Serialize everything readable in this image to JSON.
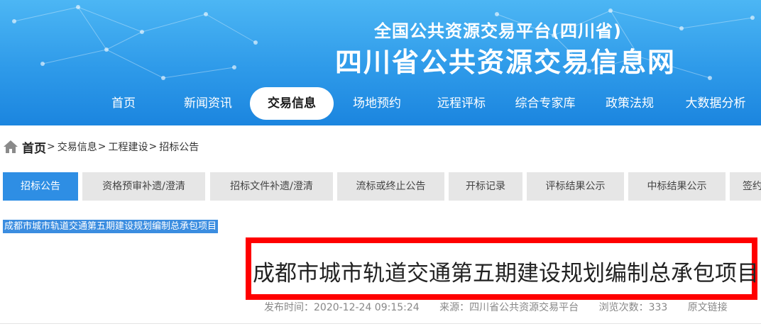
{
  "header": {
    "platform_name": "全国公共资源交易平台(四川省)",
    "site_name": "四川省公共资源交易信息网"
  },
  "nav": {
    "items": [
      "首页",
      "新闻资讯",
      "交易信息",
      "场地预约",
      "远程评标",
      "综合专家库",
      "政策法规",
      "大数据分析"
    ],
    "active": "交易信息"
  },
  "breadcrumb": {
    "home": "首页",
    "separator": ">",
    "items": [
      "交易信息",
      "工程建设",
      "招标公告"
    ]
  },
  "tabs": {
    "items": [
      "招标公告",
      "资格预审补遗/澄清",
      "招标文件补遗/澄清",
      "流标或终止公告",
      "开标记录",
      "评标结果公示",
      "中标结果公示",
      "签约"
    ],
    "active": "招标公告"
  },
  "article": {
    "highlighted_title": "成都市城市轨道交通第五期建设规划编制总承包项目",
    "title": "成都市城市轨道交通第五期建设规划编制总承包项目",
    "publish_time": "发布时间：2020-12-24 09:15:24",
    "source": "来源：四川省公共资源交易平台",
    "views": "浏览次数：333",
    "original_link": "原文链接"
  },
  "colors": {
    "banner": "#2e9ae9",
    "tab_active": "#2e8ee4",
    "highlight_box": "#ff0000"
  }
}
